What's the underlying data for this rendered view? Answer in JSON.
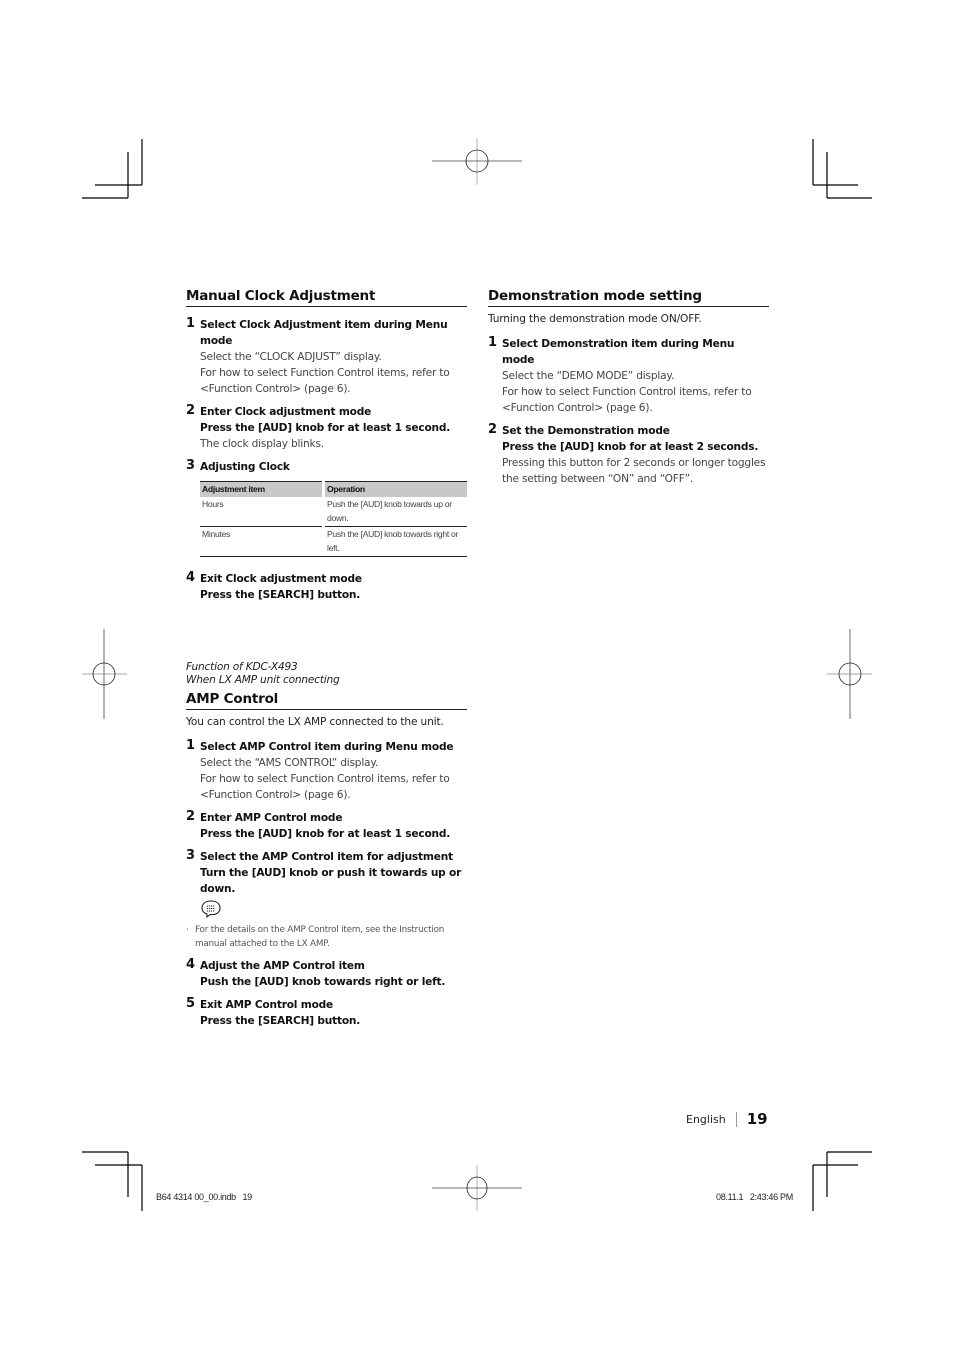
{
  "left_column": {
    "manual_clock": {
      "title": "Manual Clock Adjustment",
      "steps": [
        {
          "num": "1",
          "title": "Select Clock Adjustment item during Menu mode",
          "lines": [
            "Select the “CLOCK ADJUST” display.",
            "For how to select Function Control items, refer to <Function Control> (page 6)."
          ]
        },
        {
          "num": "2",
          "title": "Enter Clock adjustment mode",
          "bold": "Press the [AUD] knob for at least 1 second.",
          "lines": [
            "The clock display blinks."
          ]
        },
        {
          "num": "3",
          "title": "Adjusting Clock"
        },
        {
          "num": "4",
          "title": "Exit Clock adjustment mode",
          "bold": "Press the [SEARCH] button."
        }
      ],
      "table": {
        "headers": [
          "Adjustment item",
          "Operation"
        ],
        "rows": [
          [
            "Hours",
            "Push the [AUD] knob towards up or down."
          ],
          [
            "Minutes",
            "Push the [AUD] knob towards right or left."
          ]
        ]
      }
    },
    "amp_control": {
      "function_note_1": "Function of  KDC-X493",
      "function_note_2": "When LX AMP unit connecting",
      "title": "AMP Control",
      "intro": "You can control the LX AMP connected to the unit.",
      "steps": [
        {
          "num": "1",
          "title": "Select AMP Control item during Menu mode",
          "lines": [
            "Select the “AMS CONTROL” display.",
            "For how to select Function Control items, refer to <Function Control> (page 6)."
          ]
        },
        {
          "num": "2",
          "title": "Enter AMP Control mode",
          "bold": "Press the [AUD] knob for at least 1 second."
        },
        {
          "num": "3",
          "title": "Select the AMP Control item for adjustment",
          "bold": "Turn the [AUD] knob or push it towards up or down.",
          "note_icon": "speech-bubble-note-icon",
          "note": "For the details on the AMP Control item, see the Instruction manual attached to the LX AMP."
        },
        {
          "num": "4",
          "title": "Adjust the AMP Control item",
          "bold": "Push the [AUD] knob towards right or left."
        },
        {
          "num": "5",
          "title": "Exit AMP Control mode",
          "bold": "Press the [SEARCH] button."
        }
      ]
    }
  },
  "right_column": {
    "demo": {
      "title": "Demonstration mode setting",
      "intro": "Turning the demonstration mode ON/OFF.",
      "steps": [
        {
          "num": "1",
          "title": "Select Demonstration item during Menu mode",
          "lines": [
            "Select the “DEMO MODE” display.",
            "For how to select Function Control items, refer to <Function Control> (page 6)."
          ]
        },
        {
          "num": "2",
          "title": "Set the Demonstration mode",
          "bold": "Press the [AUD] knob for at least 2 seconds.",
          "lines": [
            "Pressing this button for 2 seconds or longer toggles the setting between “ON” and “OFF”."
          ]
        }
      ]
    }
  },
  "footer": {
    "language": "English",
    "page_number": "19",
    "slug_file": "B64 4314 00_00.indb   19",
    "slug_date": "08.11.1   2:43:46 PM"
  }
}
